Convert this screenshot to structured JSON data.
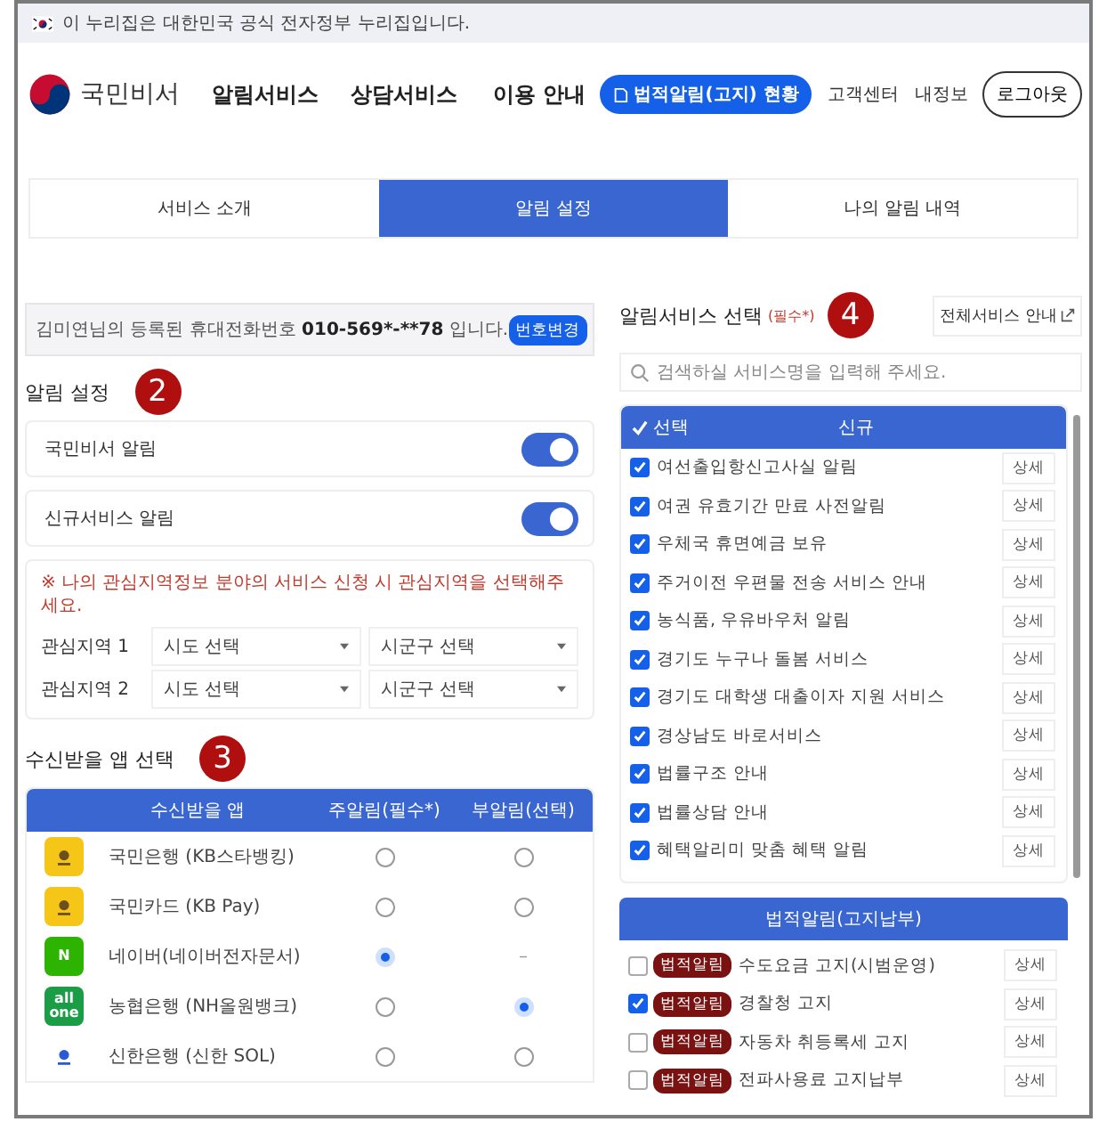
{
  "gov_banner": {
    "text": "이 누리집은 대한민국 공식 전자정부 누리집입니다."
  },
  "header": {
    "logo_text": "국민비서",
    "nav": [
      "알림서비스",
      "상담서비스",
      "이용 안내"
    ],
    "legal_button": "법적알림(고지) 현황",
    "links": [
      "고객센터",
      "내정보"
    ],
    "logout": "로그아웃"
  },
  "tabs": [
    {
      "label": "서비스 소개",
      "selected": false
    },
    {
      "label": "알림 설정",
      "selected": true
    },
    {
      "label": "나의 알림 내역",
      "selected": false
    }
  ],
  "phone_notice": {
    "text_before": "김미연님의 등록된 휴대전화번호",
    "number": "010-569*-**78",
    "text_after": "입니다.",
    "button": "번호변경"
  },
  "alarm_settings": {
    "title": "알림 설정",
    "step": "2",
    "toggles": [
      {
        "label": "국민비서 알림",
        "on": true
      },
      {
        "label": "신규서비스 알림",
        "on": true
      }
    ]
  },
  "interest_regions": {
    "notice": "※ 나의 관심지역정보 분야의 서비스 신청 시 관심지역을 선택해주세요.",
    "rows": [
      {
        "label": "관심지역 1",
        "province": "시도 선택",
        "district": "시군구 선택"
      },
      {
        "label": "관심지역 2",
        "province": "시도 선택",
        "district": "시군구 선택"
      }
    ]
  },
  "app_select": {
    "title": "수신받을 앱 선택",
    "step": "3",
    "columns": [
      "수신받을 앱",
      "주알림(필수*)",
      "부알림(선택)"
    ],
    "rows": [
      {
        "name": "국민은행 (KB스타뱅킹)",
        "color": "#f5c518",
        "main_selected": false,
        "sub": {
          "kind": "radio",
          "selected": false
        }
      },
      {
        "name": "국민카드 (KB Pay)",
        "color": "#f5c518",
        "main_selected": false,
        "sub": {
          "kind": "radio",
          "selected": false
        }
      },
      {
        "name": "네이버(네이버전자문서)",
        "color": "#2db400",
        "icon_text": "N",
        "main_selected": true,
        "sub": {
          "kind": "dash",
          "text": "–"
        }
      },
      {
        "name": "농협은행 (NH올원뱅크)",
        "color": "#1b9c47",
        "icon_text": "all one",
        "main_selected": false,
        "sub": {
          "kind": "radio",
          "selected": true
        }
      },
      {
        "name": "신한은행 (신한 SOL)",
        "color": "#ffffff",
        "main_selected": false,
        "sub": {
          "kind": "radio",
          "selected": false
        }
      }
    ]
  },
  "service_select": {
    "title": "알림서비스 선택",
    "required": "(필수*)",
    "step": "4",
    "guide_button": "전체서비스 안내",
    "search": {
      "placeholder": "검색하실 서비스명을 입력해 주세요."
    },
    "columns": [
      "선택",
      "신규"
    ],
    "services": [
      {
        "name": "여선출입항신고사실 알림",
        "checked": true,
        "detail": "상세"
      },
      {
        "name": "여권 유효기간 만료 사전알림",
        "checked": true,
        "detail": "상세"
      },
      {
        "name": "우체국 휴면예금 보유",
        "checked": true,
        "detail": "상세"
      },
      {
        "name": "주거이전 우편물 전송 서비스 안내",
        "checked": true,
        "detail": "상세"
      },
      {
        "name": "농식품, 우유바우처 알림",
        "checked": true,
        "detail": "상세"
      },
      {
        "name": "경기도 누구나 돌봄 서비스",
        "checked": true,
        "detail": "상세"
      },
      {
        "name": "경기도 대학생 대출이자 지원 서비스",
        "checked": true,
        "detail": "상세"
      },
      {
        "name": "경상남도 바로서비스",
        "checked": true,
        "detail": "상세"
      },
      {
        "name": "법률구조 안내",
        "checked": true,
        "detail": "상세"
      },
      {
        "name": "법률상담 안내",
        "checked": true,
        "detail": "상세"
      },
      {
        "name": "혜택알리미 맞춤 혜택 알림",
        "checked": true,
        "detail": "상세"
      }
    ],
    "legal_title": "법적알림(고지납부)",
    "legal": [
      {
        "tag": "법적알림",
        "name": "수도요금 고지(시범운영)",
        "checked": false,
        "detail": "상세"
      },
      {
        "tag": "법적알림",
        "name": "경찰청 고지",
        "checked": true,
        "detail": "상세"
      },
      {
        "tag": "법적알림",
        "name": "자동차 취등록세 고지",
        "checked": false,
        "detail": "상세"
      },
      {
        "tag": "법적알림",
        "name": "전파사용료 고지납부",
        "checked": false,
        "detail": "상세"
      }
    ]
  }
}
